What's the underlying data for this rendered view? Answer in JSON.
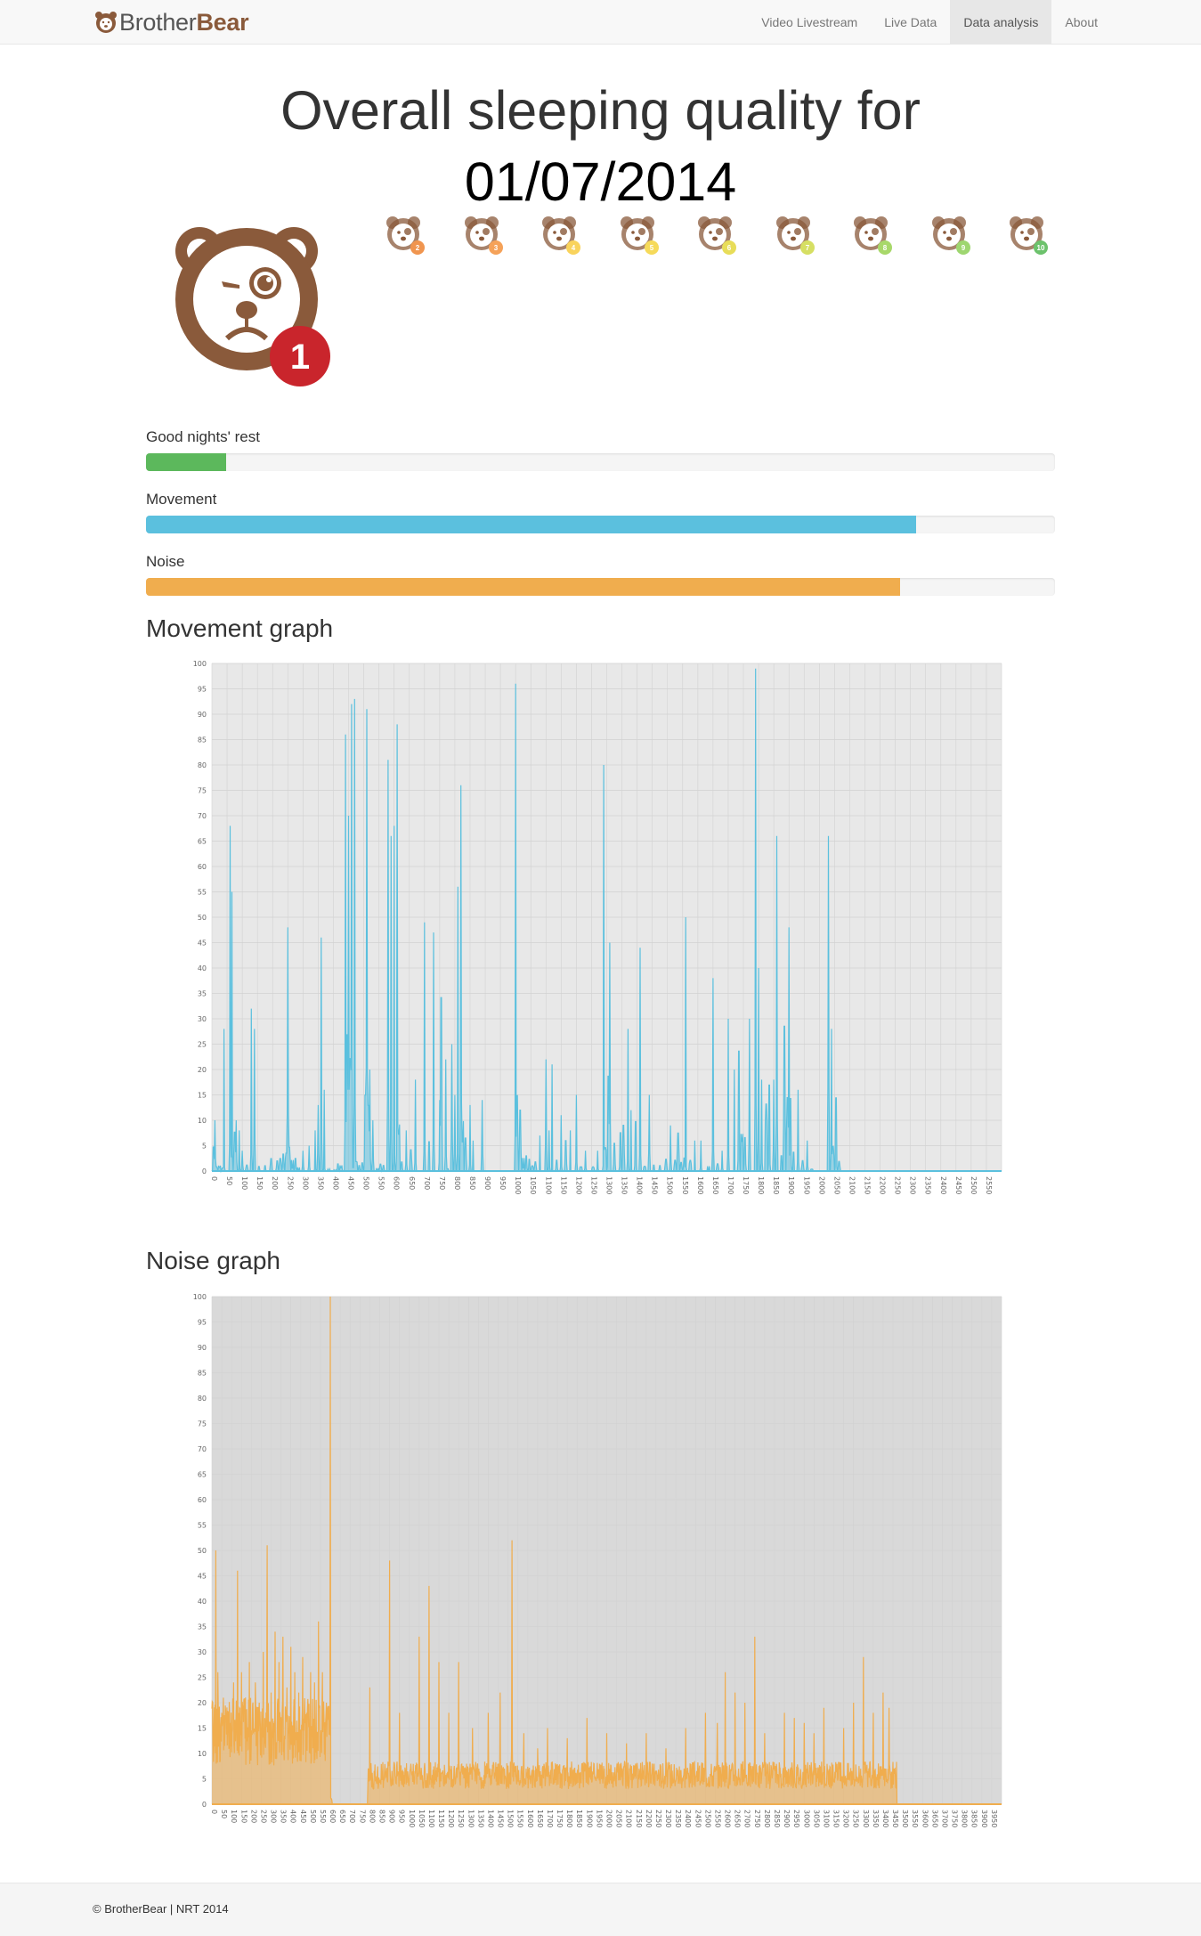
{
  "navbar": {
    "brand_light": "Brother",
    "brand_bold": "Bear",
    "links": [
      {
        "label": "Video Livestream",
        "active": false
      },
      {
        "label": "Live Data",
        "active": false
      },
      {
        "label": "Data analysis",
        "active": true
      },
      {
        "label": "About",
        "active": false
      }
    ]
  },
  "page": {
    "title_line1": "Overall sleeping quality for",
    "date": "01/07/2014"
  },
  "rating": {
    "current": "1",
    "current_badge_color": "#c9252c",
    "scale": [
      {
        "label": "2",
        "color": "#f0954f"
      },
      {
        "label": "3",
        "color": "#f5a259"
      },
      {
        "label": "4",
        "color": "#f9d35c"
      },
      {
        "label": "5",
        "color": "#f6da5a"
      },
      {
        "label": "6",
        "color": "#e8dd59"
      },
      {
        "label": "7",
        "color": "#d6df63"
      },
      {
        "label": "8",
        "color": "#a8d86a"
      },
      {
        "label": "9",
        "color": "#9ed670"
      },
      {
        "label": "10",
        "color": "#6cc26c"
      }
    ],
    "bear_color": "#8a5a3b"
  },
  "metrics": [
    {
      "label": "Good nights' rest",
      "percent": 8.8,
      "color": "#5cb85c"
    },
    {
      "label": "Movement",
      "percent": 84.7,
      "color": "#5bc0de"
    },
    {
      "label": "Noise",
      "percent": 83.0,
      "color": "#f0ad4e"
    }
  ],
  "movement_section_title": "Movement graph",
  "noise_section_title": "Noise graph",
  "chart_data": [
    {
      "type": "area",
      "xmax": 2600,
      "xtick_step": 50,
      "ylim": [
        0,
        100
      ],
      "ytick_step": 5,
      "color": "#5bc0de",
      "background": "#e8e8e8",
      "peaks": [
        [
          5,
          14
        ],
        [
          10,
          10
        ],
        [
          15,
          6
        ],
        [
          25,
          8
        ],
        [
          35,
          4
        ],
        [
          40,
          28
        ],
        [
          60,
          68
        ],
        [
          66,
          55
        ],
        [
          75,
          48
        ],
        [
          80,
          10
        ],
        [
          90,
          8
        ],
        [
          100,
          4
        ],
        [
          115,
          5
        ],
        [
          130,
          32
        ],
        [
          140,
          28
        ],
        [
          155,
          6
        ],
        [
          175,
          4
        ],
        [
          195,
          9
        ],
        [
          215,
          6
        ],
        [
          225,
          11
        ],
        [
          235,
          32
        ],
        [
          245,
          27
        ],
        [
          250,
          48
        ],
        [
          255,
          40
        ],
        [
          265,
          38
        ],
        [
          275,
          8
        ],
        [
          285,
          6
        ],
        [
          300,
          4
        ],
        [
          320,
          5
        ],
        [
          340,
          8
        ],
        [
          350,
          13
        ],
        [
          360,
          46
        ],
        [
          370,
          16
        ],
        [
          385,
          6
        ],
        [
          405,
          10
        ],
        [
          415,
          15
        ],
        [
          425,
          14
        ],
        [
          435,
          8
        ],
        [
          440,
          86
        ],
        [
          445,
          100
        ],
        [
          450,
          70
        ],
        [
          455,
          99
        ],
        [
          460,
          92
        ],
        [
          465,
          98
        ],
        [
          470,
          93
        ],
        [
          475,
          15
        ],
        [
          485,
          6
        ],
        [
          495,
          5
        ],
        [
          505,
          46
        ],
        [
          510,
          91
        ],
        [
          515,
          76
        ],
        [
          520,
          20
        ],
        [
          530,
          10
        ],
        [
          545,
          8
        ],
        [
          555,
          6
        ],
        [
          565,
          4
        ],
        [
          580,
          81
        ],
        [
          590,
          66
        ],
        [
          600,
          68
        ],
        [
          610,
          88
        ],
        [
          615,
          72
        ],
        [
          625,
          10
        ],
        [
          640,
          8
        ],
        [
          655,
          16
        ],
        [
          670,
          18
        ],
        [
          700,
          49
        ],
        [
          715,
          18
        ],
        [
          730,
          47
        ],
        [
          750,
          14
        ],
        [
          755,
          92
        ],
        [
          770,
          22
        ],
        [
          775,
          18
        ],
        [
          790,
          25
        ],
        [
          800,
          15
        ],
        [
          810,
          56
        ],
        [
          820,
          76
        ],
        [
          825,
          84
        ],
        [
          835,
          19
        ],
        [
          850,
          13
        ],
        [
          860,
          6
        ],
        [
          890,
          14
        ],
        [
          1000,
          96
        ],
        [
          1005,
          45
        ],
        [
          1015,
          48
        ],
        [
          1025,
          20
        ],
        [
          1035,
          14
        ],
        [
          1045,
          12
        ],
        [
          1055,
          8
        ],
        [
          1065,
          10
        ],
        [
          1080,
          7
        ],
        [
          1100,
          22
        ],
        [
          1110,
          8
        ],
        [
          1120,
          21
        ],
        [
          1135,
          19
        ],
        [
          1150,
          11
        ],
        [
          1165,
          17
        ],
        [
          1180,
          8
        ],
        [
          1200,
          15
        ],
        [
          1215,
          11
        ],
        [
          1230,
          4
        ],
        [
          1255,
          5
        ],
        [
          1270,
          4
        ],
        [
          1290,
          80
        ],
        [
          1295,
          48
        ],
        [
          1305,
          54
        ],
        [
          1310,
          45
        ],
        [
          1325,
          18
        ],
        [
          1345,
          23
        ],
        [
          1355,
          42
        ],
        [
          1370,
          28
        ],
        [
          1380,
          12
        ],
        [
          1395,
          39
        ],
        [
          1410,
          44
        ],
        [
          1425,
          12
        ],
        [
          1440,
          15
        ],
        [
          1455,
          10
        ],
        [
          1475,
          29
        ],
        [
          1495,
          22
        ],
        [
          1510,
          9
        ],
        [
          1525,
          12
        ],
        [
          1535,
          64
        ],
        [
          1545,
          22
        ],
        [
          1555,
          12
        ],
        [
          1560,
          50
        ],
        [
          1575,
          15
        ],
        [
          1590,
          6
        ],
        [
          1610,
          6
        ],
        [
          1635,
          29
        ],
        [
          1650,
          38
        ],
        [
          1665,
          14
        ],
        [
          1680,
          4
        ],
        [
          1700,
          30
        ],
        [
          1720,
          20
        ],
        [
          1735,
          83
        ],
        [
          1745,
          61
        ],
        [
          1755,
          27
        ],
        [
          1770,
          30
        ],
        [
          1790,
          99
        ],
        [
          1800,
          40
        ],
        [
          1810,
          18
        ],
        [
          1825,
          74
        ],
        [
          1835,
          48
        ],
        [
          1850,
          18
        ],
        [
          1860,
          66
        ],
        [
          1875,
          10
        ],
        [
          1885,
          78
        ],
        [
          1895,
          63
        ],
        [
          1900,
          48
        ],
        [
          1905,
          39
        ],
        [
          1915,
          19
        ],
        [
          1930,
          16
        ],
        [
          1945,
          12
        ],
        [
          1960,
          6
        ],
        [
          1975,
          4
        ],
        [
          2030,
          66
        ],
        [
          2040,
          28
        ],
        [
          2045,
          24
        ],
        [
          2055,
          45
        ],
        [
          2065,
          8
        ]
      ],
      "series_end": 2080
    },
    {
      "type": "area",
      "xmax": 4000,
      "xtick_step": 50,
      "ylim": [
        0,
        100
      ],
      "ytick_step": 5,
      "color": "#f0ad4e",
      "background": "#d9d9d9",
      "peaks": [
        [
          5,
          38
        ],
        [
          20,
          50
        ],
        [
          30,
          26
        ],
        [
          50,
          18
        ],
        [
          70,
          14
        ],
        [
          110,
          24
        ],
        [
          130,
          46
        ],
        [
          150,
          26
        ],
        [
          170,
          21
        ],
        [
          190,
          28
        ],
        [
          220,
          24
        ],
        [
          240,
          20
        ],
        [
          260,
          30
        ],
        [
          280,
          51
        ],
        [
          300,
          22
        ],
        [
          320,
          34
        ],
        [
          340,
          28
        ],
        [
          360,
          33
        ],
        [
          380,
          23
        ],
        [
          400,
          31
        ],
        [
          420,
          26
        ],
        [
          440,
          22
        ],
        [
          460,
          29
        ],
        [
          480,
          18
        ],
        [
          500,
          26
        ],
        [
          520,
          24
        ],
        [
          540,
          36
        ],
        [
          560,
          26
        ],
        [
          580,
          20
        ],
        [
          595,
          49
        ],
        [
          600,
          100
        ],
        [
          605,
          20
        ]
      ],
      "dense_segments": [
        [
          0,
          15,
          600
        ],
        [
          790,
          6,
          3470
        ]
      ],
      "extra_peaks": [
        [
          800,
          23
        ],
        [
          900,
          48
        ],
        [
          950,
          18
        ],
        [
          1050,
          33
        ],
        [
          1100,
          43
        ],
        [
          1150,
          28
        ],
        [
          1200,
          18
        ],
        [
          1250,
          28
        ],
        [
          1320,
          15
        ],
        [
          1400,
          18
        ],
        [
          1460,
          22
        ],
        [
          1520,
          52
        ],
        [
          1580,
          14
        ],
        [
          1650,
          11
        ],
        [
          1700,
          15
        ],
        [
          1800,
          13
        ],
        [
          1900,
          17
        ],
        [
          2000,
          14
        ],
        [
          2100,
          12
        ],
        [
          2200,
          14
        ],
        [
          2300,
          11
        ],
        [
          2400,
          15
        ],
        [
          2500,
          18
        ],
        [
          2560,
          16
        ],
        [
          2600,
          26
        ],
        [
          2650,
          22
        ],
        [
          2700,
          20
        ],
        [
          2750,
          33
        ],
        [
          2800,
          14
        ],
        [
          2900,
          18
        ],
        [
          2950,
          17
        ],
        [
          3000,
          16
        ],
        [
          3050,
          14
        ],
        [
          3100,
          19
        ],
        [
          3200,
          15
        ],
        [
          3250,
          20
        ],
        [
          3300,
          29
        ],
        [
          3350,
          18
        ],
        [
          3400,
          22
        ],
        [
          3430,
          19
        ],
        [
          3460,
          7
        ]
      ],
      "series_end": 3470
    }
  ],
  "footer": {
    "text": "© BrotherBear | NRT 2014"
  }
}
